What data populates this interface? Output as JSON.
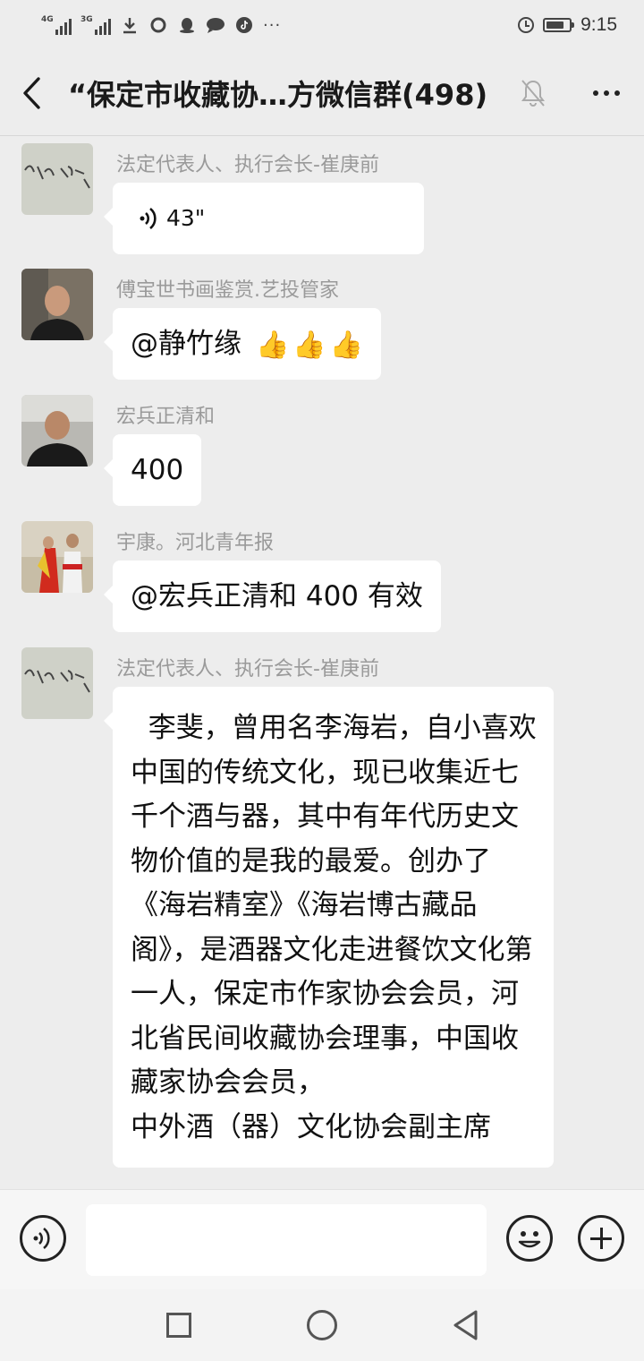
{
  "status_bar": {
    "network1": "4G",
    "network2": "3G",
    "icons": [
      "download-icon",
      "browser-icon",
      "qq-icon",
      "chat-bubble-icon",
      "tiktok-icon"
    ],
    "more": "···",
    "time": "9:15",
    "battery_level": 0.8
  },
  "header": {
    "title": "“保定市收藏协…方微信群(498)"
  },
  "messages": [
    {
      "sender": "法定代表人、执行会长-崔庚前",
      "type": "voice",
      "duration": "43\""
    },
    {
      "sender": "傅宝世书画鉴赏.艺投管家",
      "type": "text",
      "text": "@静竹缘",
      "emoji": [
        "👍",
        "👍",
        "👍"
      ]
    },
    {
      "sender": "宏兵正清和",
      "type": "text",
      "text": "400"
    },
    {
      "sender": "宇康。河北青年报",
      "type": "text",
      "text": "@宏兵正清和 400 有效"
    },
    {
      "sender": "法定代表人、执行会长-崔庚前",
      "type": "text",
      "text": "  李斐，曾用名李海岩，自小喜欢中国的传统文化，现已收集近七千个酒与器，其中有年代历史文物价值的是我的最爱。创办了《海岩精室》《海岩博古藏品阁》，是酒器文化走进餐饮文化第一人，保定市作家协会会员，河北省民间收藏协会理事，中国收藏家协会会员，\n中外酒（器）文化协会副主席"
    }
  ],
  "input": {
    "placeholder": ""
  },
  "colors": {
    "background": "#ededed",
    "bubble": "#ffffff",
    "sender_name": "#9a9a9a"
  }
}
